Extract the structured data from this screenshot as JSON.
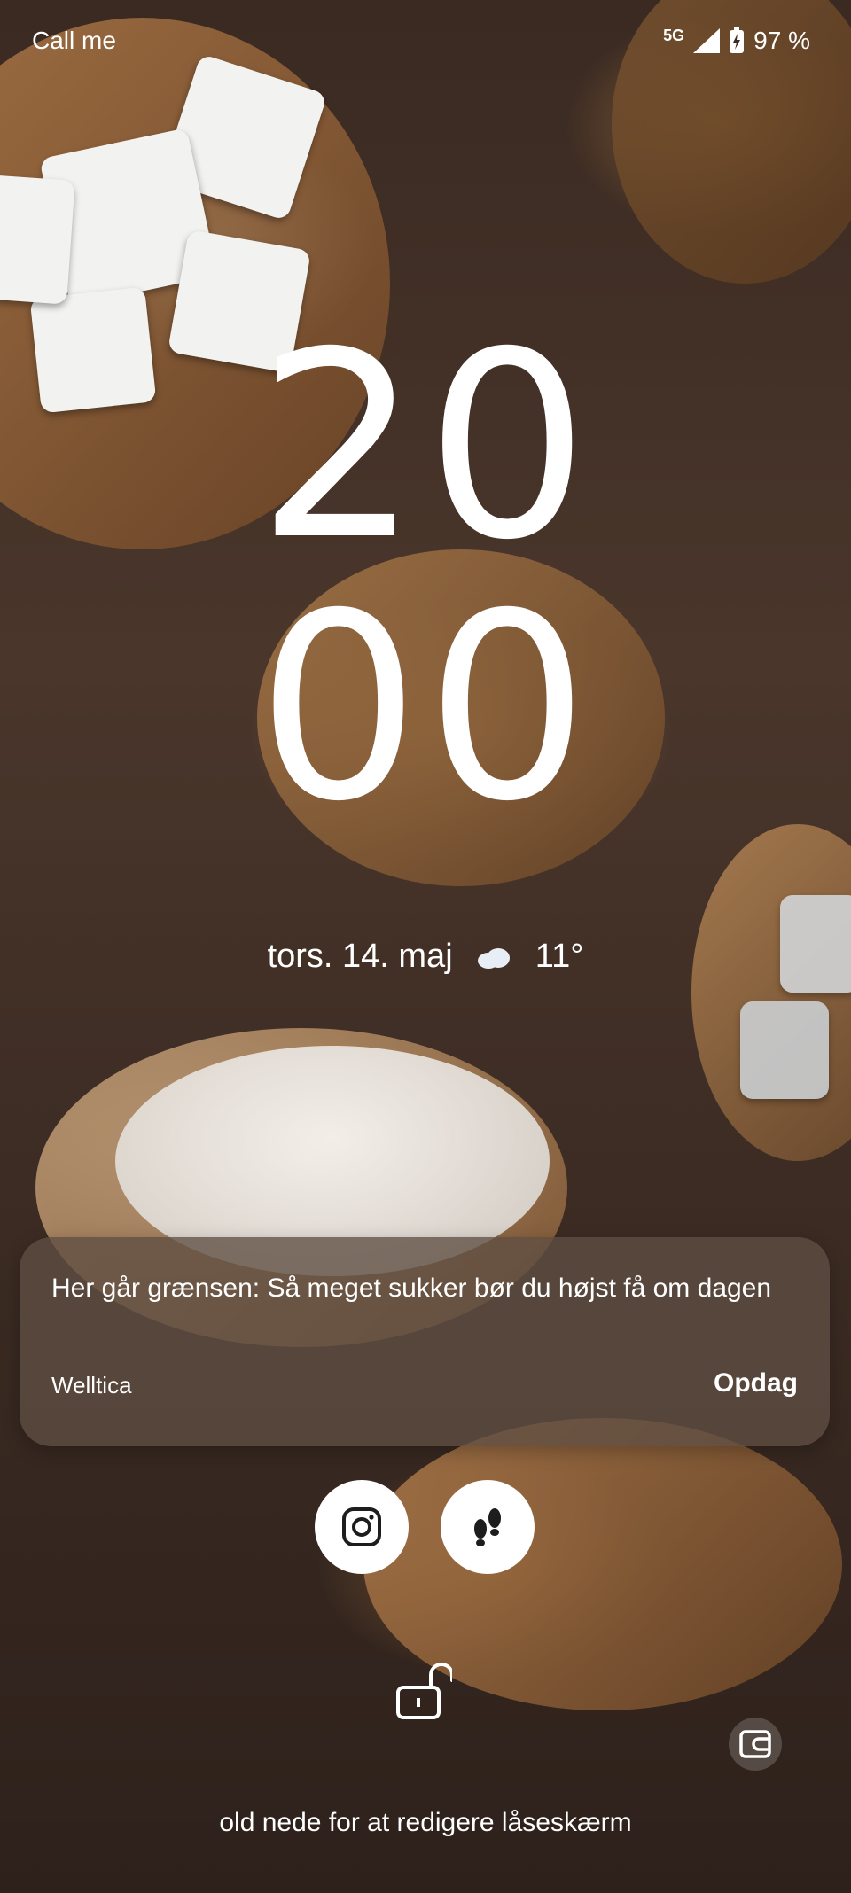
{
  "status_bar": {
    "carrier": "Call me",
    "network": "5G",
    "battery": "97 %"
  },
  "clock": {
    "hours": "20",
    "minutes": "00"
  },
  "date_weather": {
    "date": "tors. 14. maj",
    "weather_icon": "cloud-icon",
    "temperature": "11°"
  },
  "notification": {
    "title": "Her går grænsen: Så meget sukker bør du højst få om dagen",
    "source": "Welltica",
    "action": "Opdag"
  },
  "shortcuts": [
    {
      "name": "instagram",
      "icon": "instagram-icon"
    },
    {
      "name": "steps",
      "icon": "footsteps-icon"
    }
  ],
  "lock_icon": "unlock-icon",
  "wallet_icon": "wallet-icon",
  "hint": "old nede for at redigere låseskærm"
}
